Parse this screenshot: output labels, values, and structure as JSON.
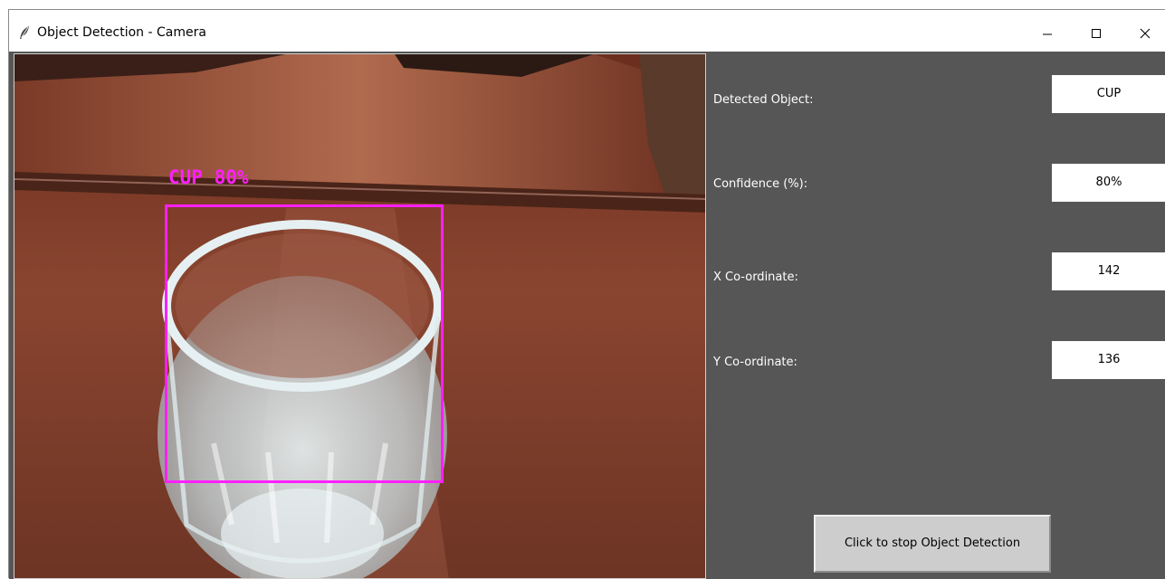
{
  "window": {
    "title": "Object Detection - Camera",
    "icon": "feather-icon",
    "controls": [
      "minimize-icon",
      "maximize-icon",
      "close-icon"
    ]
  },
  "camera": {
    "overlay_label": "CUP 80%",
    "overlay_color": "#ff1fff"
  },
  "fields": [
    {
      "label": "Detected Object:",
      "value": "CUP"
    },
    {
      "label": "Confidence (%):",
      "value": "80%"
    },
    {
      "label": "X Co-ordinate:",
      "value": "142"
    },
    {
      "label": "Y Co-ordinate:",
      "value": "136"
    }
  ],
  "stop_button": {
    "label": "Click to stop Object Detection"
  },
  "colors": {
    "panel_background": "#565656",
    "field_background": "#ffffff",
    "button_background": "#cdcdcd"
  }
}
